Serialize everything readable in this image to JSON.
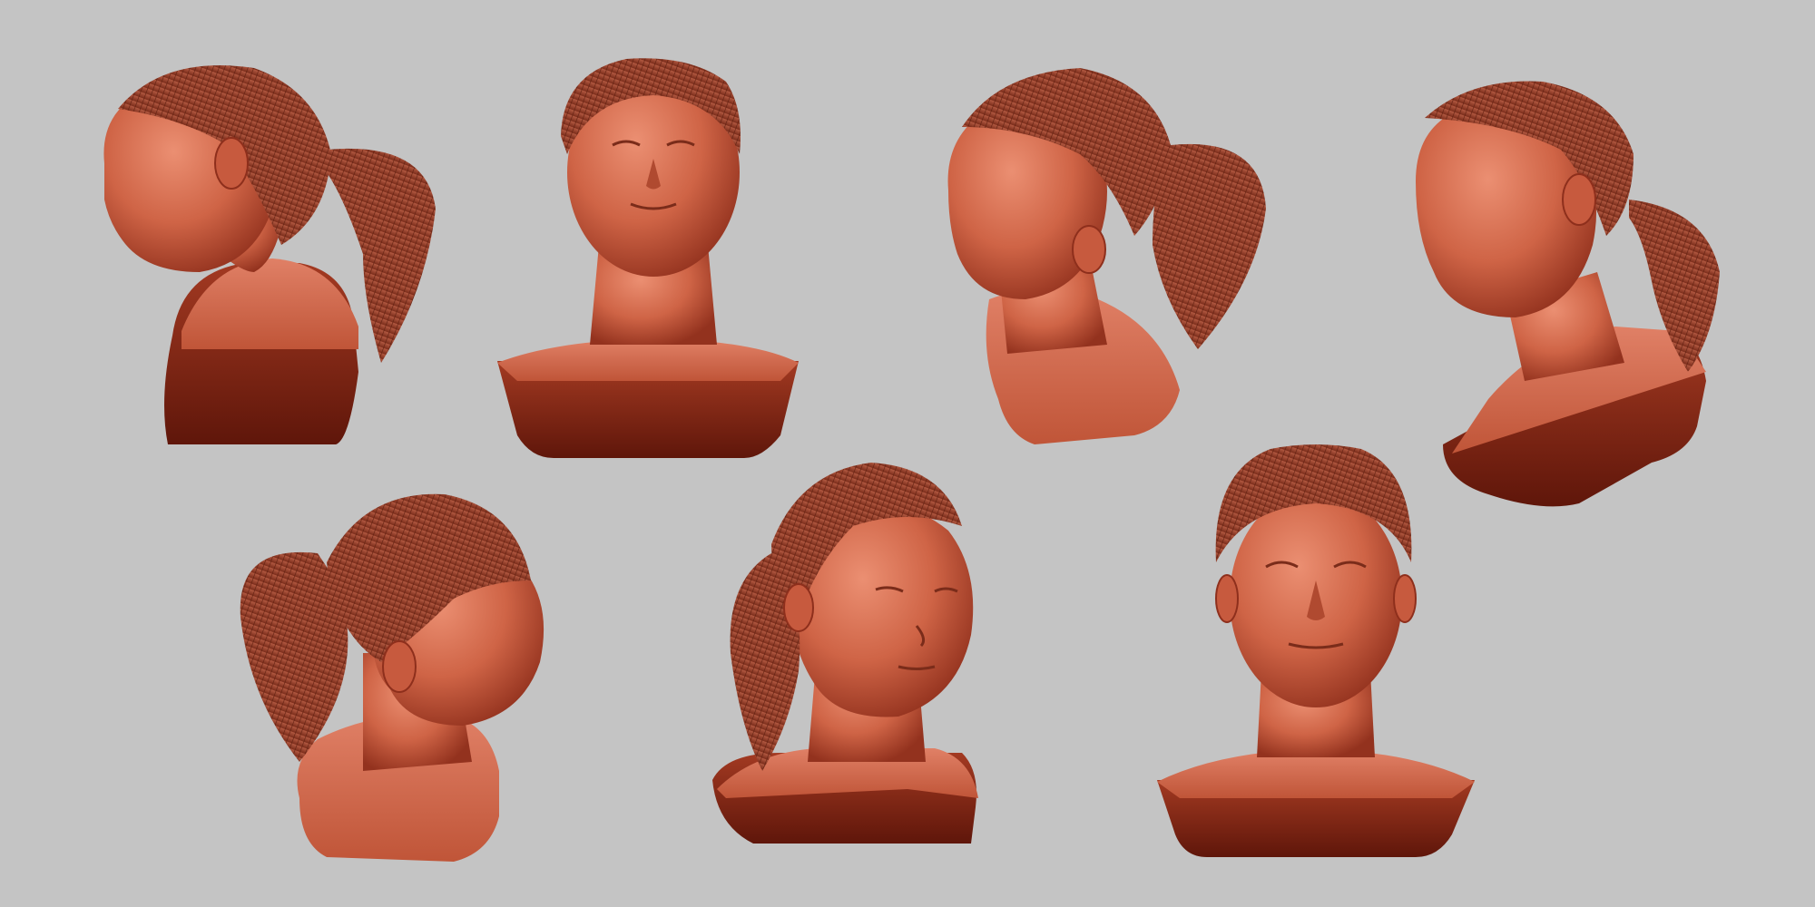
{
  "scene": {
    "background": "#c4c4c4",
    "material": {
      "clay_light": "#e07a5c",
      "clay_mid": "#c75a3e",
      "clay_dark": "#8e2f1c",
      "clay_shadow": "#5a1508"
    },
    "busts": [
      {
        "name": "bust-left-profile",
        "view": "left-profile"
      },
      {
        "name": "bust-front-upward",
        "view": "front-upward"
      },
      {
        "name": "bust-left-three-quarter-down",
        "view": "left-three-quarter-down"
      },
      {
        "name": "bust-left-three-quarter-tilt",
        "view": "left-three-quarter-tilt"
      },
      {
        "name": "bust-right-profile",
        "view": "right-profile"
      },
      {
        "name": "bust-right-three-quarter",
        "view": "right-three-quarter"
      },
      {
        "name": "bust-front",
        "view": "front"
      }
    ]
  }
}
